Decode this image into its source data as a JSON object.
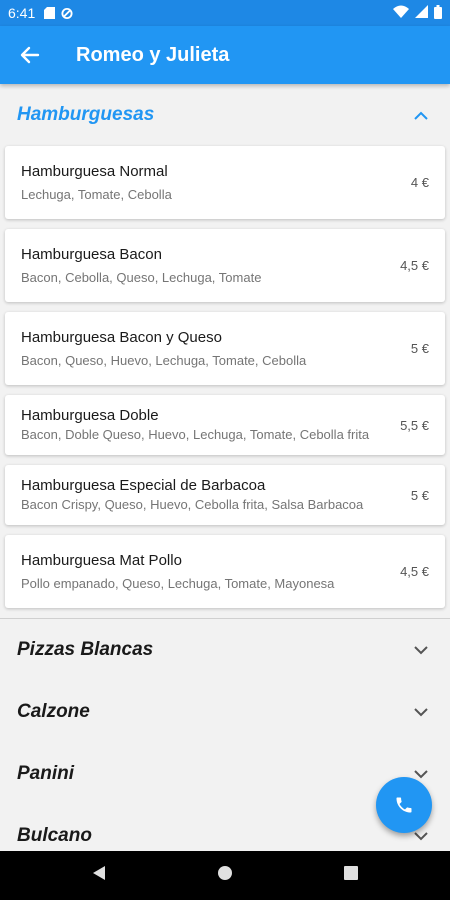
{
  "status_bar": {
    "time": "6:41"
  },
  "app_bar": {
    "title": "Romeo y Julieta"
  },
  "sections": [
    {
      "label": "Hamburguesas",
      "expanded": true,
      "items": [
        {
          "name": "Hamburguesa Normal",
          "description": "Lechuga, Tomate, Cebolla",
          "price": "4 €"
        },
        {
          "name": "Hamburguesa Bacon",
          "description": "Bacon, Cebolla, Queso, Lechuga, Tomate",
          "price": "4,5 €"
        },
        {
          "name": "Hamburguesa Bacon y Queso",
          "description": "Bacon, Queso, Huevo, Lechuga, Tomate, Cebolla",
          "price": "5 €"
        },
        {
          "name": "Hamburguesa Doble",
          "description": "Bacon, Doble Queso, Huevo, Lechuga, Tomate, Cebolla frita",
          "price": "5,5 €"
        },
        {
          "name": "Hamburguesa Especial de Barbacoa",
          "description": "Bacon Crispy, Queso, Huevo, Cebolla frita, Salsa Barbacoa",
          "price": "5 €"
        },
        {
          "name": "Hamburguesa Mat Pollo",
          "description": "Pollo empanado, Queso, Lechuga, Tomate, Mayonesa",
          "price": "4,5 €"
        }
      ]
    },
    {
      "label": "Pizzas Blancas",
      "expanded": false
    },
    {
      "label": "Calzone",
      "expanded": false
    },
    {
      "label": "Panini",
      "expanded": false
    },
    {
      "label": "Bulcano",
      "expanded": false
    }
  ],
  "colors": {
    "primary": "#2196f3",
    "status_bar": "#1e88e5"
  },
  "icons": {
    "back": "arrow-left-icon",
    "expand": "chevron-down-icon",
    "collapse": "chevron-up-icon",
    "fab": "phone-icon"
  }
}
